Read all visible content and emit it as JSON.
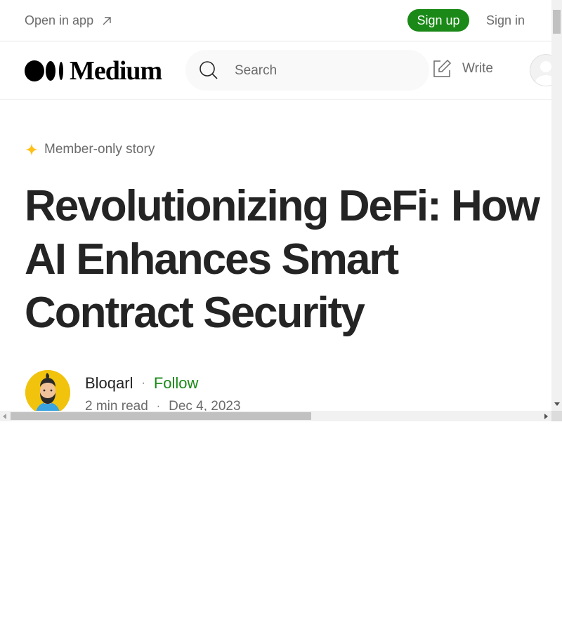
{
  "topbar": {
    "open_in_app": "Open in app",
    "sign_up": "Sign up",
    "sign_in": "Sign in"
  },
  "nav": {
    "logo_text": "Medium",
    "search_placeholder": "Search",
    "search_value": "",
    "write_label": "Write"
  },
  "article": {
    "member_badge": "Member-only story",
    "title": "Revolutionizing DeFi: How AI Enhances Smart Contract Security",
    "author": {
      "name": "Bloqarl",
      "follow_label": "Follow"
    },
    "read_time": "2 min read",
    "date": "Dec 4, 2023"
  },
  "colors": {
    "brand_green": "#1a8917",
    "text_primary": "#242424",
    "text_secondary": "#6b6b6b",
    "member_star": "#ffc017",
    "avatar_bg": "#f2c30c"
  },
  "icons": {
    "open_in_app": "arrow-up-right-icon",
    "search": "search-icon",
    "write": "write-icon",
    "member": "sparkle-icon",
    "profile": "user-avatar-icon"
  }
}
